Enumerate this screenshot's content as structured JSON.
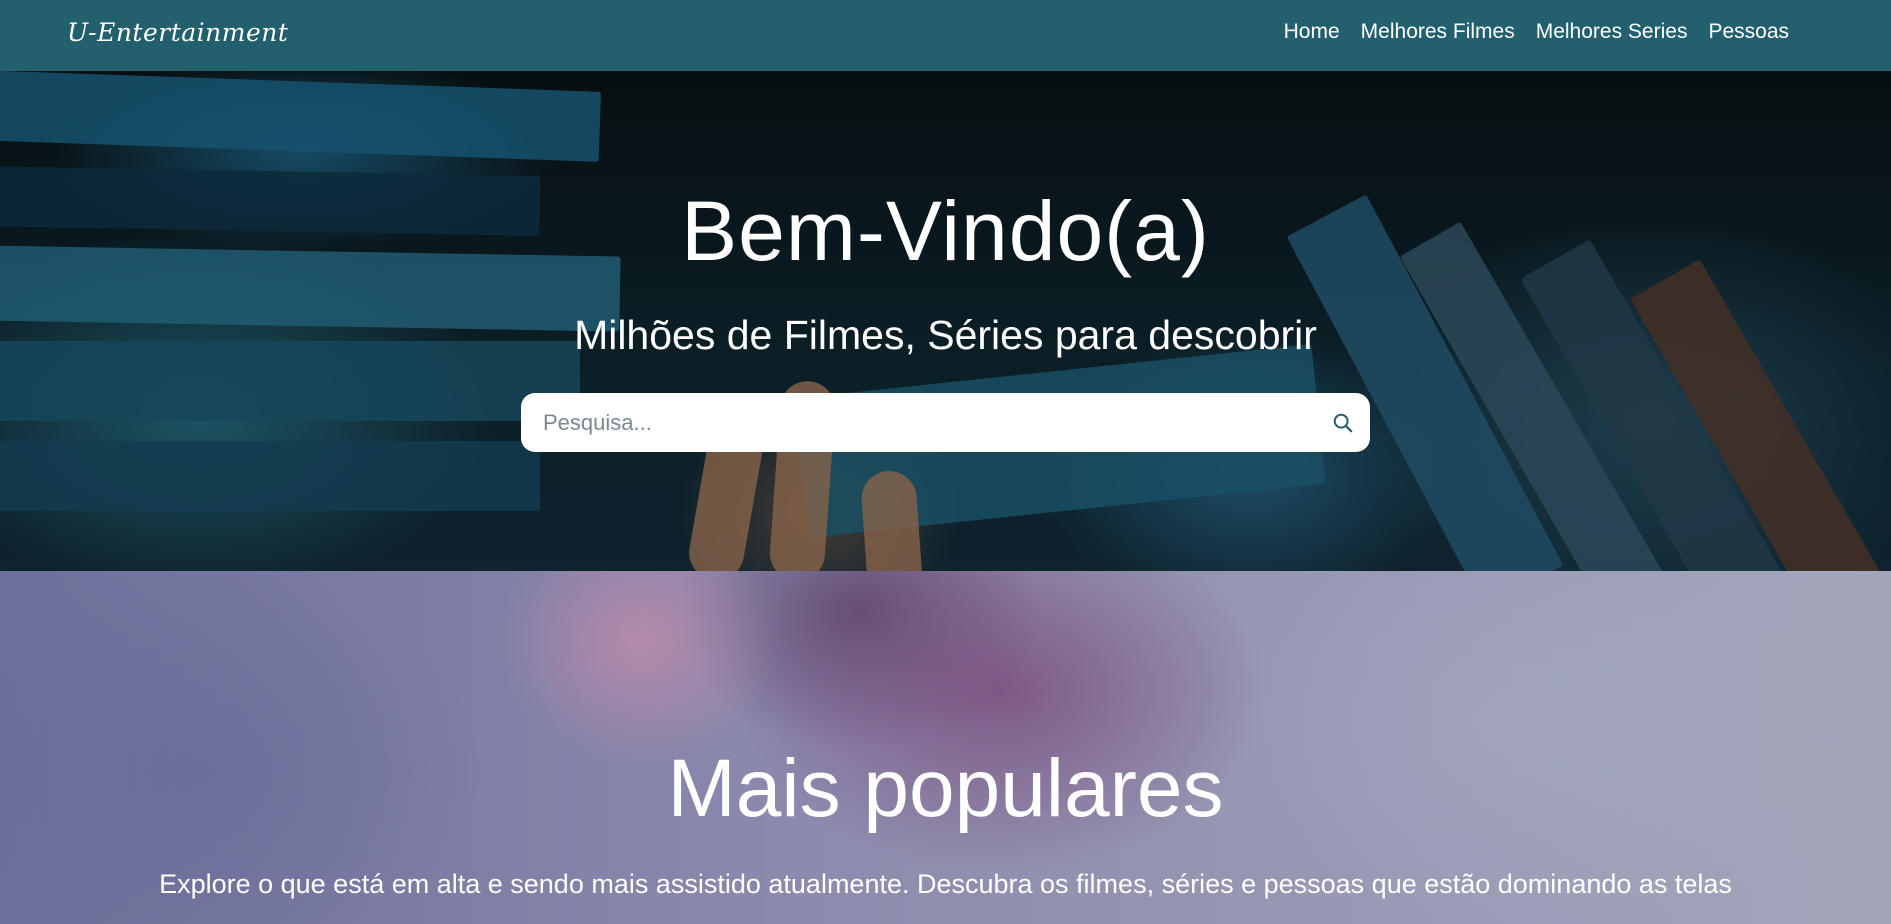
{
  "navbar": {
    "brand": "U-Entertainment",
    "links": [
      {
        "label": "Home"
      },
      {
        "label": "Melhores Filmes"
      },
      {
        "label": "Melhores Series"
      },
      {
        "label": "Pessoas"
      }
    ],
    "background_color": "#22606e"
  },
  "hero": {
    "title": "Bem-Vindo(a)",
    "subtitle": "Milhões de Filmes, Séries para descobrir",
    "search": {
      "placeholder": "Pesquisa...",
      "value": "",
      "icon": "search-icon"
    }
  },
  "popular": {
    "title": "Mais populares",
    "description": "Explore o que está em alta e sendo mais assistido atualmente. Descubra os filmes, séries e pessoas que estão dominando as telas"
  }
}
